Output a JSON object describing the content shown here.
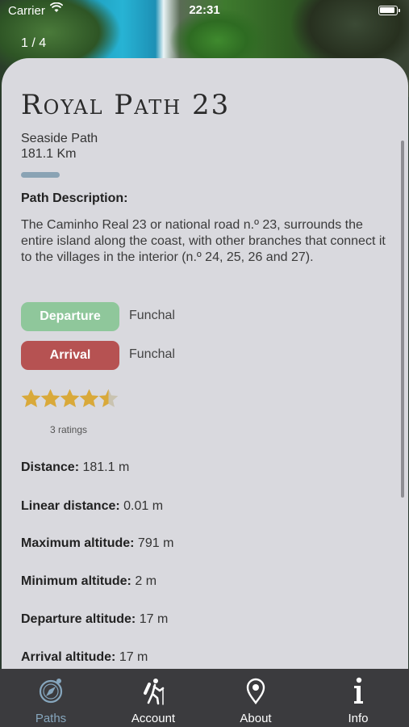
{
  "status_bar": {
    "carrier": "Carrier",
    "time": "22:31"
  },
  "gallery": {
    "page_indicator": "1 / 4"
  },
  "path": {
    "title": "Royal Path 23",
    "type": "Seaside Path",
    "length": "181.1 Km",
    "description_heading": "Path Description:",
    "description": "The Caminho Real 23 or national road n.º 23, surrounds the entire island along the coast, with other branches that connect it to the villages in the interior (n.º 24, 25, 26 and 27).",
    "departure_label": "Departure",
    "departure_place": "Funchal",
    "arrival_label": "Arrival",
    "arrival_place": "Funchal",
    "rating": 4.5,
    "rating_max": 5,
    "ratings_count": "3 ratings"
  },
  "stats": [
    {
      "label": "Distance:",
      "value": "181.1 m"
    },
    {
      "label": "Linear distance:",
      "value": "0.01 m"
    },
    {
      "label": "Maximum altitude:",
      "value": "791 m"
    },
    {
      "label": "Minimum altitude:",
      "value": "2 m"
    },
    {
      "label": "Departure altitude:",
      "value": "17 m"
    },
    {
      "label": "Arrival altitude:",
      "value": "17 m"
    }
  ],
  "tabs": [
    {
      "label": "Paths",
      "icon": "compass-icon",
      "active": true
    },
    {
      "label": "Account",
      "icon": "hiker-icon",
      "active": false
    },
    {
      "label": "About",
      "icon": "map-pin-icon",
      "active": false
    },
    {
      "label": "Info",
      "icon": "info-icon",
      "active": false
    }
  ],
  "colors": {
    "departure": "#8fc79b",
    "arrival": "#b65252",
    "star": "#d9a93a",
    "active_tab": "#86a6bd",
    "tabbar": "#3b3b3e",
    "card": "#d9d9de"
  }
}
